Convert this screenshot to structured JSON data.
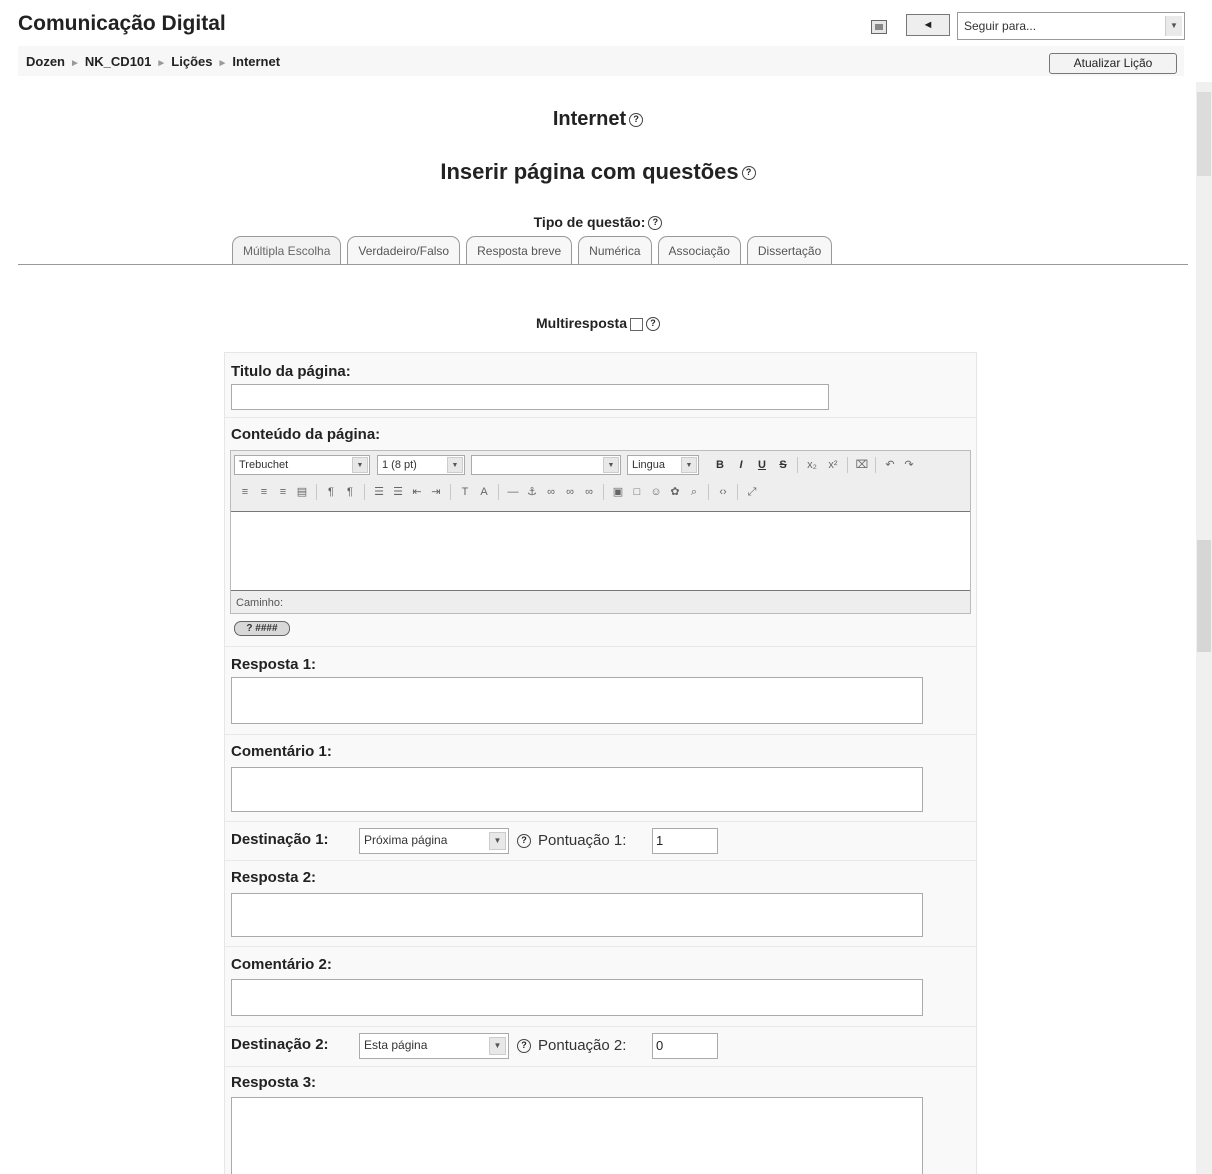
{
  "header": {
    "site_title": "Comunicação Digital",
    "prev_label": "◄",
    "jump_placeholder": "Seguir para...",
    "update_button": "Atualizar Lição"
  },
  "breadcrumb": [
    "Dozen",
    "NK_CD101",
    "Lições",
    "Internet"
  ],
  "page": {
    "lesson_title": "Internet",
    "insert_title": "Inserir página com questões",
    "question_type_label": "Tipo de questão:",
    "multi_answer_label": "Multiresposta"
  },
  "tabs": [
    "Múltipla Escolha",
    "Verdadeiro/Falso",
    "Resposta breve",
    "Numérica",
    "Associação",
    "Dissertação"
  ],
  "form": {
    "page_title_label": "Titulo da página:",
    "page_content_label": "Conteúdo da página:",
    "editor": {
      "font": "Trebuchet",
      "size": "1 (8 pt)",
      "heading": "",
      "language": "Lingua",
      "path_label": "Caminho:",
      "badge": "? ####"
    },
    "answers": [
      {
        "answer_label": "Resposta 1:",
        "comment_label": "Comentário 1:",
        "dest_label": "Destinação 1:",
        "dest_value": "Próxima página",
        "score_label": "Pontuação 1:",
        "score_value": "1"
      },
      {
        "answer_label": "Resposta 2:",
        "comment_label": "Comentário 2:",
        "dest_label": "Destinação 2:",
        "dest_value": "Esta página",
        "score_label": "Pontuação 2:",
        "score_value": "0"
      },
      {
        "answer_label": "Resposta 3:"
      }
    ]
  },
  "icons": [
    "save-icon",
    "help-icon",
    "bold-icon",
    "italic-icon",
    "underline-icon",
    "strikethrough-icon",
    "subscript-icon",
    "superscript-icon",
    "undo-icon",
    "redo-icon",
    "align-left-icon",
    "align-center-icon",
    "align-right-icon",
    "justify-icon",
    "ordered-list-icon",
    "unordered-list-icon",
    "outdent-icon",
    "indent-icon",
    "link-icon",
    "anchor-icon",
    "image-icon",
    "table-icon",
    "smiley-icon",
    "html-source-icon",
    "fullscreen-icon"
  ]
}
